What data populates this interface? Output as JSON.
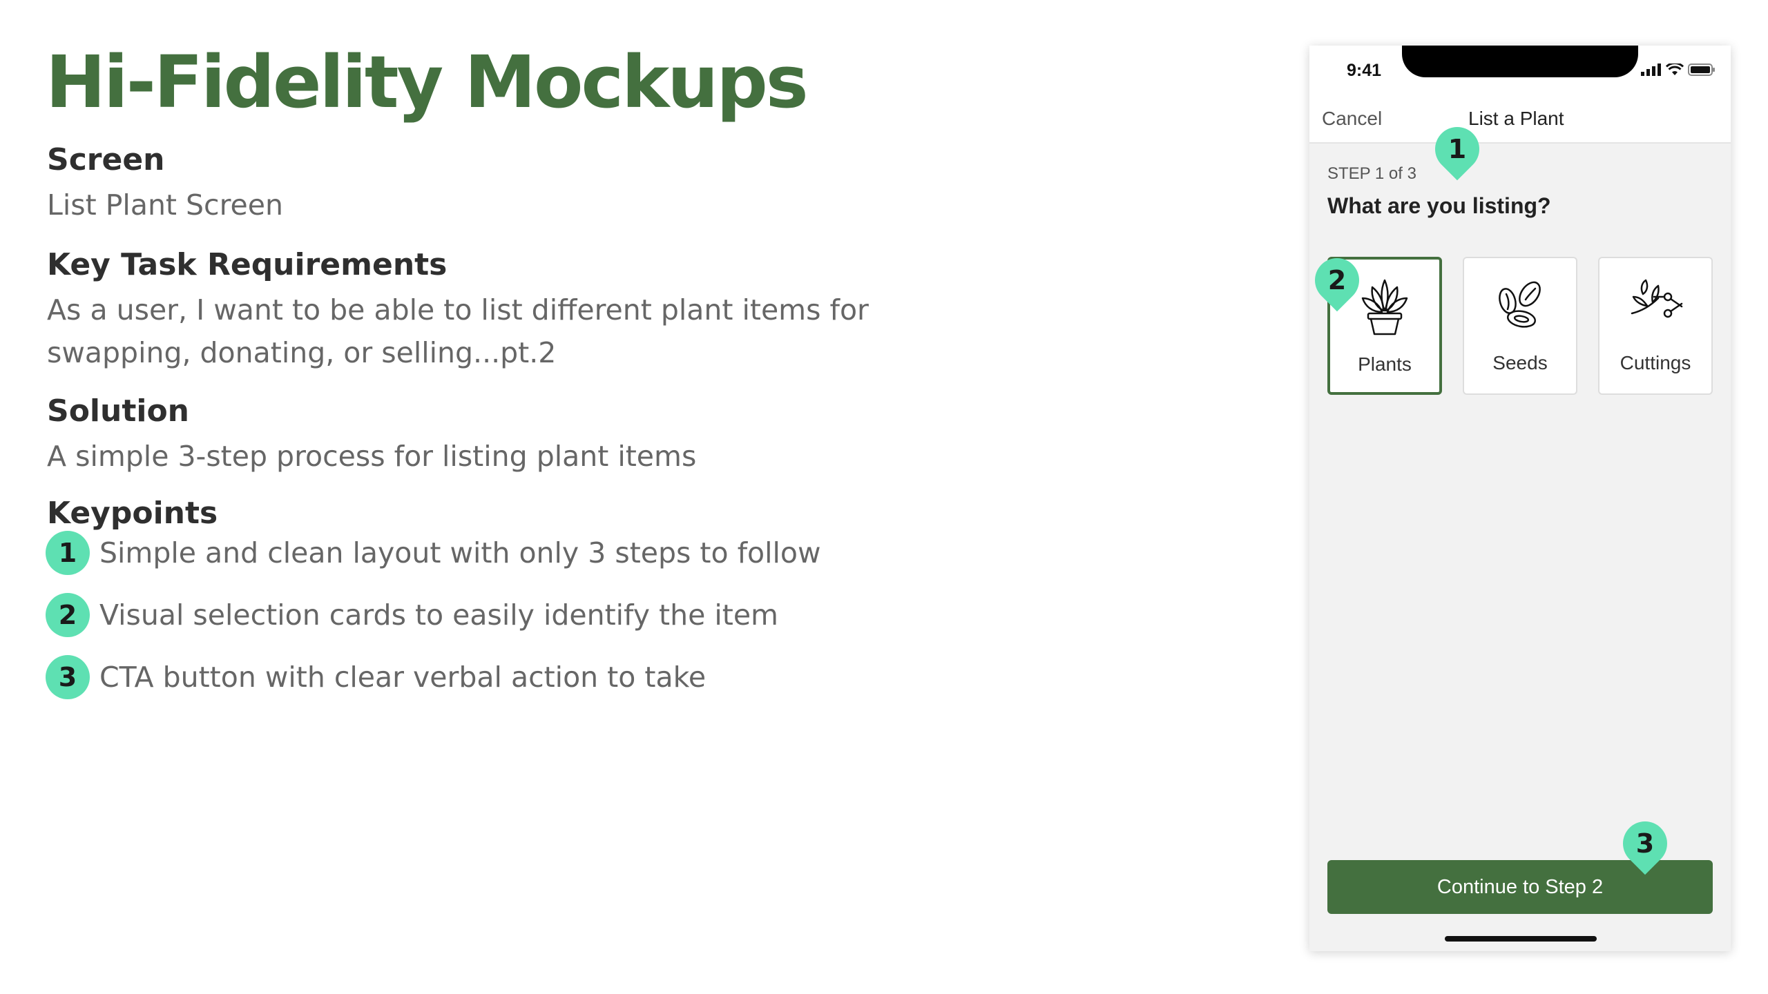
{
  "title": "Hi-Fidelity Mockups",
  "sections": {
    "screen": {
      "heading": "Screen",
      "body": "List Plant Screen"
    },
    "requirements": {
      "heading": "Key Task Requirements",
      "body_line1": "As a user, I want to be able to list different plant items for",
      "body_line2": "swapping, donating, or selling...pt.2"
    },
    "solution": {
      "heading": "Solution",
      "body": "A simple 3-step process for listing plant items"
    },
    "keypoints": {
      "heading": "Keypoints",
      "items": [
        {
          "num": "1",
          "text": "Simple and clean layout with only 3 steps to follow"
        },
        {
          "num": "2",
          "text": "Visual selection cards to easily identify the item"
        },
        {
          "num": "3",
          "text": "CTA button with clear verbal action to take"
        }
      ]
    }
  },
  "phone": {
    "status": {
      "time": "9:41",
      "icons": [
        "signal-icon",
        "wifi-icon",
        "battery-icon"
      ]
    },
    "nav": {
      "cancel": "Cancel",
      "title": "List a Plant"
    },
    "step": "STEP 1 of 3",
    "question": "What are you listing?",
    "cards": [
      {
        "label": "Plants",
        "icon": "potted-plant-icon",
        "selected": true
      },
      {
        "label": "Seeds",
        "icon": "seeds-icon",
        "selected": false
      },
      {
        "label": "Cuttings",
        "icon": "cuttings-icon",
        "selected": false
      }
    ],
    "cta": "Continue to Step 2",
    "pins": [
      "1",
      "2",
      "3"
    ]
  },
  "colors": {
    "brand_green": "#44703f",
    "marker_mint": "#5ee0b2",
    "heading": "#2f2f2f",
    "body": "#666666"
  }
}
